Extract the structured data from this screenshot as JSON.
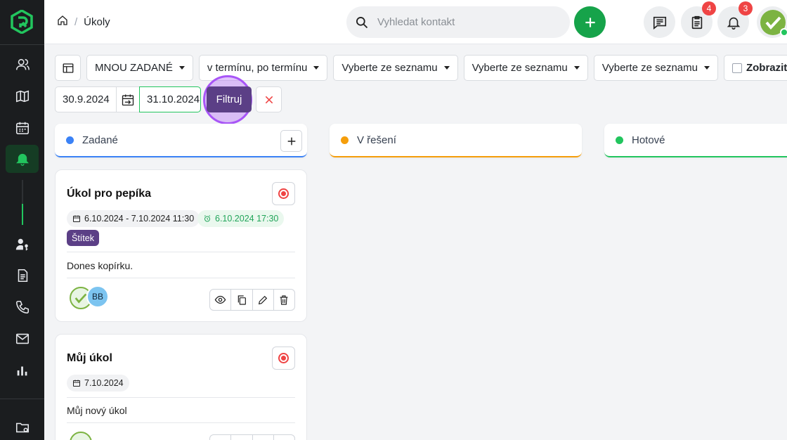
{
  "breadcrumb": {
    "home_icon": "home-icon",
    "title": "Úkoly"
  },
  "search": {
    "placeholder": "Vyhledat kontakt"
  },
  "topbar": {
    "tasks_badge": "4",
    "notifications_badge": "3"
  },
  "filters": {
    "assigned": "MNOU ZADANÉ",
    "term": "v termínu, po termínu",
    "select1": "Vyberte ze seznamu",
    "select2": "Vyberte ze seznamu",
    "select3": "Vyberte ze seznamu",
    "show_deleted": "Zobrazit smaz"
  },
  "daterange": {
    "from": "30.9.2024",
    "to": "31.10.2024",
    "filter_button": "Filtruj"
  },
  "columns": [
    {
      "label": "Zadané",
      "color": "#3b82f6"
    },
    {
      "label": "V řešení",
      "color": "#f59e0b"
    },
    {
      "label": "Hotové",
      "color": "#22c55e"
    }
  ],
  "cards": [
    {
      "title": "Úkol pro pepíka",
      "date_range": "6.10.2024 - 7.10.2024 11:30",
      "reminder": "6.10.2024 17:30",
      "tag": "Štítek",
      "description": "Dones kopírku.",
      "avatar_initials": "BB"
    },
    {
      "title": "Můj úkol",
      "date_range": "7.10.2024",
      "description": "Můj nový úkol"
    }
  ]
}
